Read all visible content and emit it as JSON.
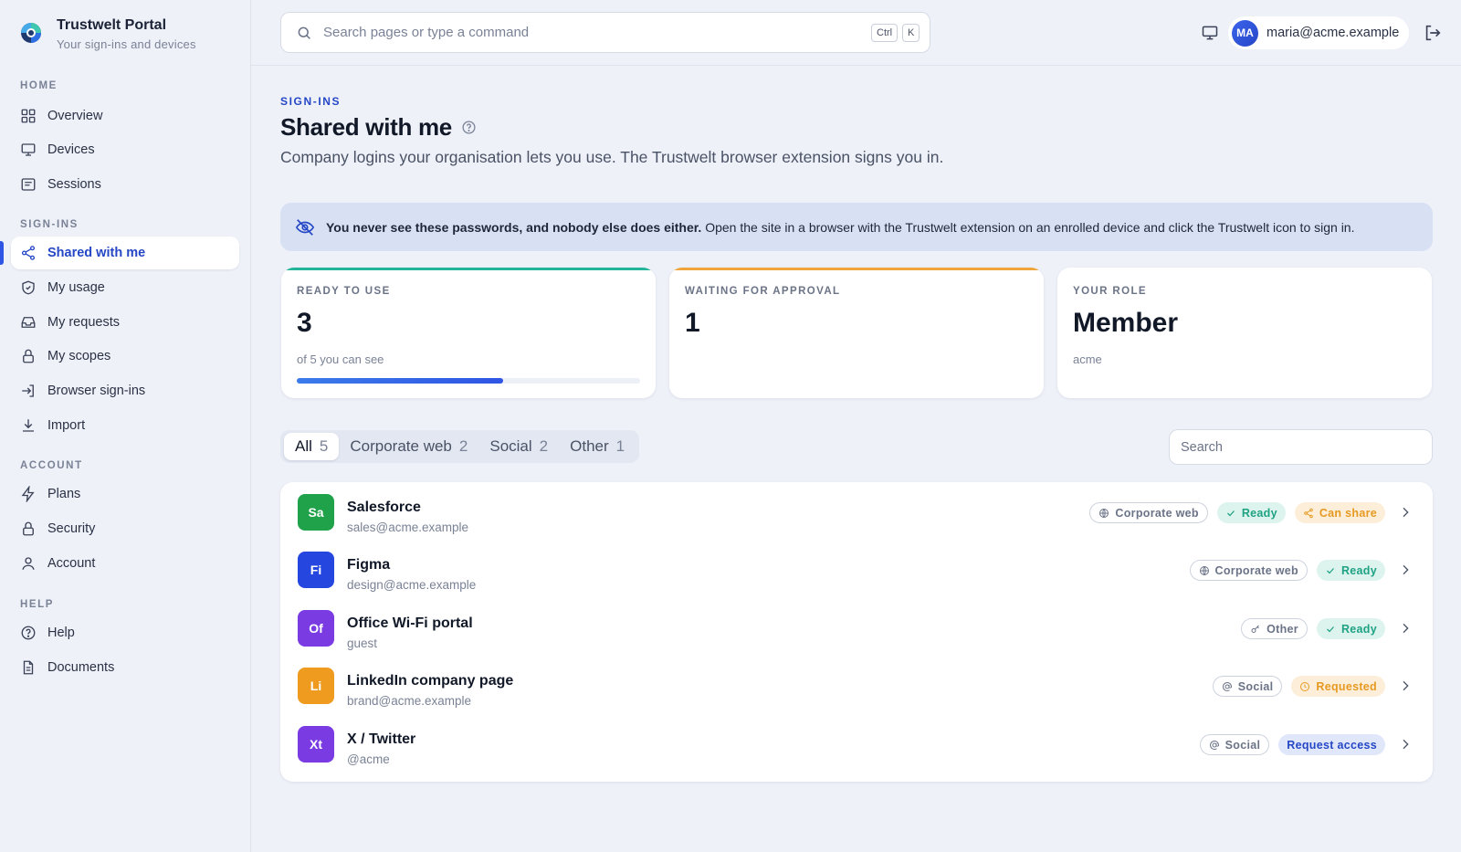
{
  "brand": {
    "title": "Trustwelt Portal",
    "subtitle": "Your sign-ins and devices"
  },
  "sidebar": {
    "sections": [
      {
        "label": "HOME"
      },
      {
        "label": "SIGN-INS"
      },
      {
        "label": "ACCOUNT"
      },
      {
        "label": "HELP"
      }
    ],
    "items": [
      {
        "label": "Overview",
        "icon": "grid-icon"
      },
      {
        "label": "Devices",
        "icon": "monitor-icon"
      },
      {
        "label": "Sessions",
        "icon": "sessions-icon"
      },
      {
        "label": "Shared with me",
        "icon": "share-icon",
        "active": true
      },
      {
        "label": "My usage",
        "icon": "shield-icon"
      },
      {
        "label": "My requests",
        "icon": "inbox-icon"
      },
      {
        "label": "My scopes",
        "icon": "lock-icon"
      },
      {
        "label": "Browser sign-ins",
        "icon": "sign-in-icon"
      },
      {
        "label": "Import",
        "icon": "download-icon"
      },
      {
        "label": "Plans",
        "icon": "bolt-icon"
      },
      {
        "label": "Security",
        "icon": "lock-icon"
      },
      {
        "label": "Account",
        "icon": "user-icon"
      },
      {
        "label": "Help",
        "icon": "help-circle-icon"
      },
      {
        "label": "Documents",
        "icon": "document-icon"
      }
    ]
  },
  "topbar": {
    "search_placeholder": "Search pages or type a command",
    "kbd_ctrl": "Ctrl",
    "kbd_k": "K",
    "user_initials": "MA",
    "user_email": "maria@acme.example"
  },
  "page": {
    "eyebrow": "SIGN-INS",
    "title": "Shared with me",
    "subtitle": "Company logins your organisation lets you use. The Trustwelt browser extension signs you in."
  },
  "banner": {
    "bold": "You never see these passwords, and nobody else does either.",
    "text": " Open the site in a browser with the Trustwelt extension on an enrolled device and click the Trustwelt icon to sign in."
  },
  "cards": [
    {
      "label": "READY TO USE",
      "value": "3",
      "note": "of 5 you can see",
      "progress": 0.6,
      "accent": "#22b59a"
    },
    {
      "label": "WAITING FOR APPROVAL",
      "value": "1",
      "note": "",
      "accent": "#f0a53a"
    },
    {
      "label": "YOUR ROLE",
      "value": "Member",
      "note": "acme"
    }
  ],
  "tabs": [
    {
      "label": "All",
      "count": "5",
      "active": true
    },
    {
      "label": "Corporate web",
      "count": "2"
    },
    {
      "label": "Social",
      "count": "2"
    },
    {
      "label": "Other",
      "count": "1"
    }
  ],
  "list_search_placeholder": "Search",
  "rows": [
    {
      "initials": "Sa",
      "name": "Salesforce",
      "sub": "sales@acme.example",
      "color": "#1fa24a",
      "badges": [
        {
          "kind": "cat",
          "icon": "globe-icon",
          "label": "Corporate web"
        },
        {
          "kind": "ready",
          "icon": "check-icon",
          "label": "Ready"
        },
        {
          "kind": "share",
          "icon": "share-icon",
          "label": "Can share"
        }
      ]
    },
    {
      "initials": "Fi",
      "name": "Figma",
      "sub": "design@acme.example",
      "color": "#2547e0",
      "badges": [
        {
          "kind": "cat",
          "icon": "globe-icon",
          "label": "Corporate web"
        },
        {
          "kind": "ready",
          "icon": "check-icon",
          "label": "Ready"
        }
      ]
    },
    {
      "initials": "Of",
      "name": "Office Wi-Fi portal",
      "sub": "guest",
      "color": "#7a3be3",
      "badges": [
        {
          "kind": "cat",
          "icon": "key-icon",
          "label": "Other"
        },
        {
          "kind": "ready",
          "icon": "check-icon",
          "label": "Ready"
        }
      ]
    },
    {
      "initials": "Li",
      "name": "LinkedIn company page",
      "sub": "brand@acme.example",
      "color": "#ee9b20",
      "badges": [
        {
          "kind": "cat",
          "icon": "at-icon",
          "label": "Social"
        },
        {
          "kind": "req",
          "icon": "clock-icon",
          "label": "Requested"
        }
      ]
    },
    {
      "initials": "Xt",
      "name": "X / Twitter",
      "sub": "@acme",
      "color": "#7a3be3",
      "badges": [
        {
          "kind": "cat",
          "icon": "at-icon",
          "label": "Social"
        },
        {
          "kind": "access",
          "icon": "",
          "label": "Request access"
        }
      ]
    }
  ]
}
